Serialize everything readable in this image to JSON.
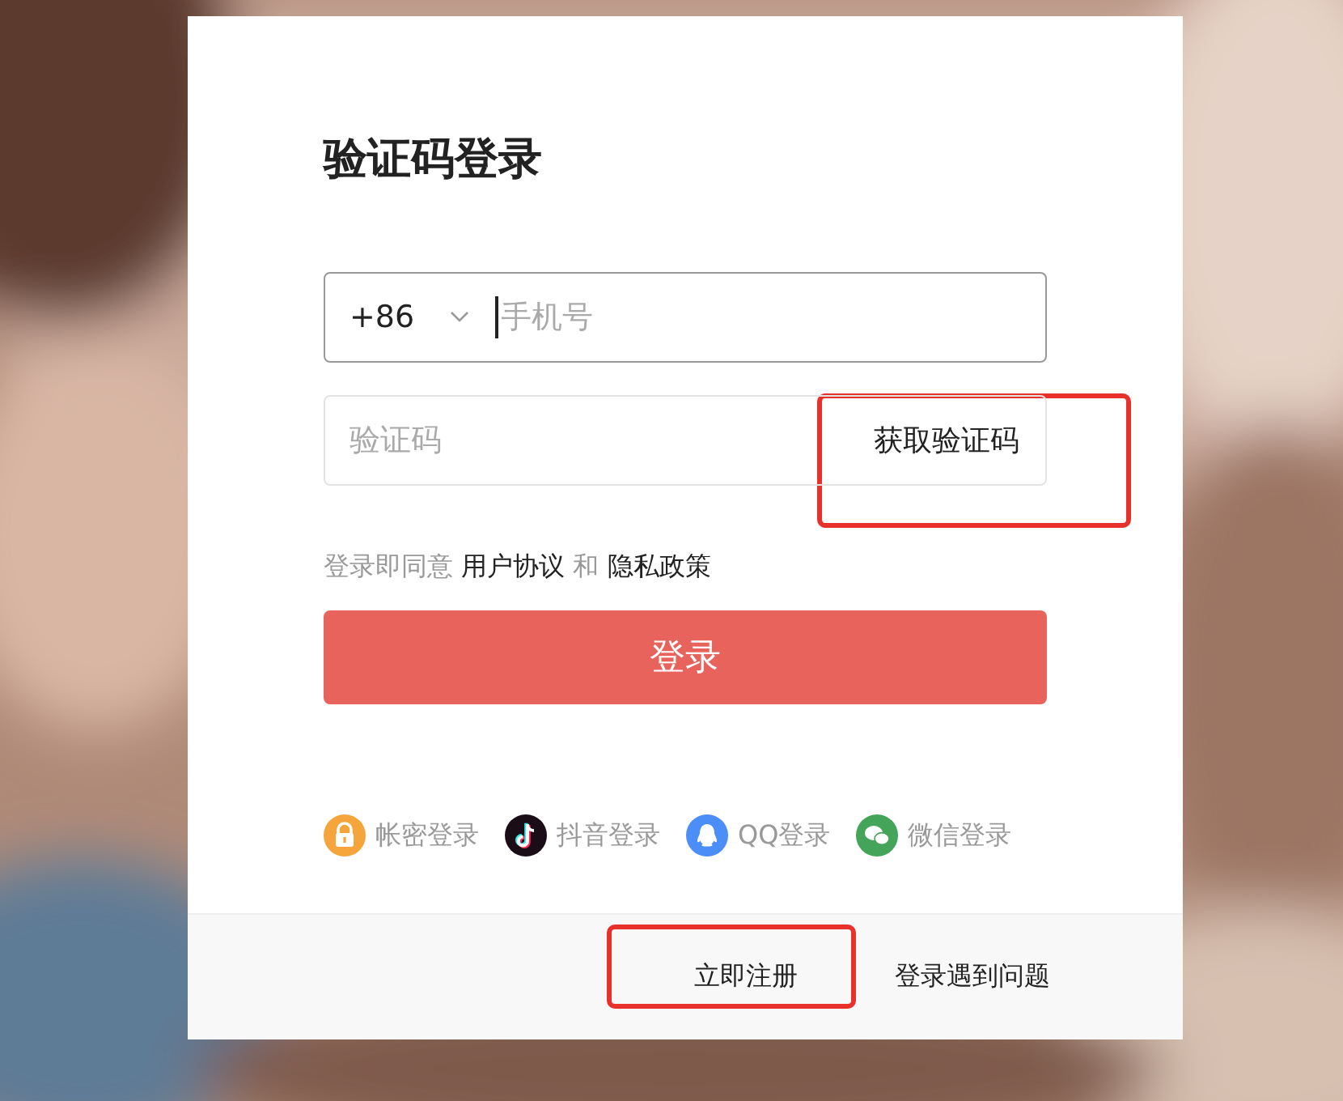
{
  "title": "验证码登录",
  "phone": {
    "country_code": "+86",
    "placeholder": "手机号"
  },
  "code": {
    "placeholder": "验证码",
    "button": "获取验证码",
    "highlighted": true
  },
  "agreement": {
    "prefix": "登录即同意",
    "link1": "用户协议",
    "joiner": "和",
    "link2": "隐私政策"
  },
  "submit": "登录",
  "alt_logins": [
    {
      "kind": "lock",
      "label": "帐密登录",
      "color": "#f5a53b"
    },
    {
      "kind": "tiktok",
      "label": "抖音登录",
      "color": "#1a0d17"
    },
    {
      "kind": "qq",
      "label": "QQ登录",
      "color": "#4b8ef7"
    },
    {
      "kind": "wechat",
      "label": "微信登录",
      "color": "#44a55a"
    }
  ],
  "footer": {
    "register": "立即注册",
    "register_highlighted": true,
    "help": "登录遇到问题"
  }
}
